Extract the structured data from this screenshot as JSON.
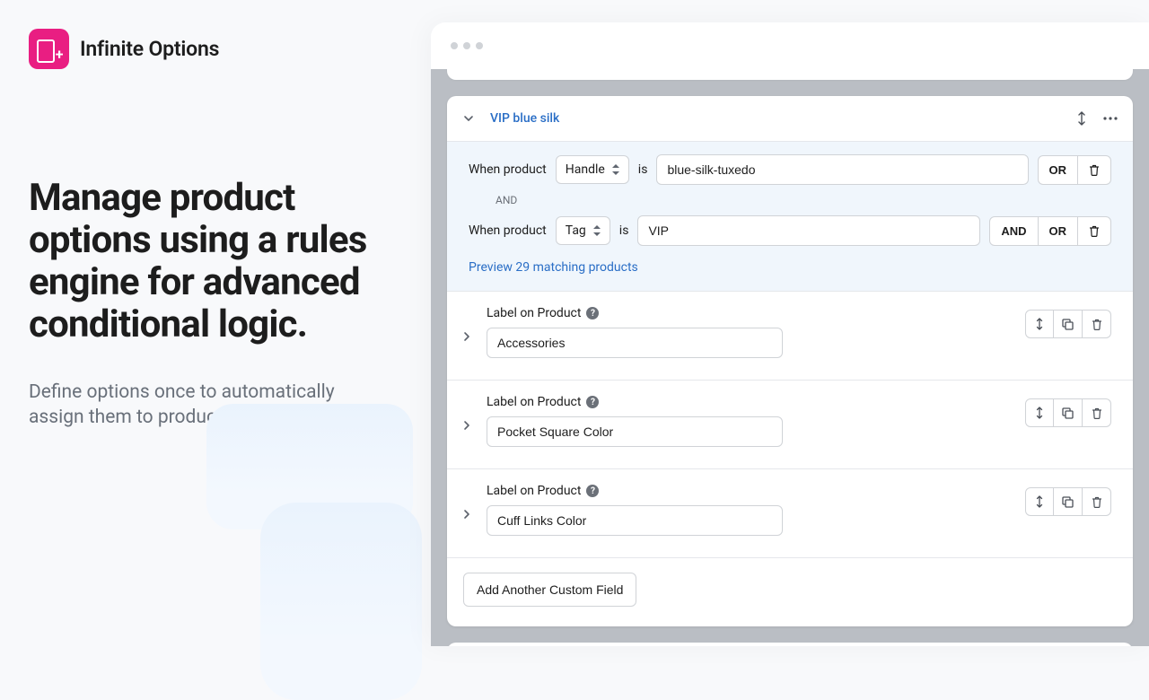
{
  "brand": {
    "name": "Infinite Options"
  },
  "marketing": {
    "headline": "Manage product options using a rules engine for advanced conditional logic.",
    "subheadline": "Define options once to automatically assign them to products."
  },
  "rule": {
    "title": "VIP blue silk",
    "conditions": {
      "label": "When product",
      "isLabel": "is",
      "joiner": "AND",
      "row1": {
        "selector": "Handle",
        "value": "blue-silk-tuxedo",
        "buttons": {
          "or": "OR"
        }
      },
      "row2": {
        "selector": "Tag",
        "value": "VIP",
        "buttons": {
          "and": "AND",
          "or": "OR"
        }
      },
      "preview": "Preview 29 matching products"
    },
    "optionLabel": "Label on Product",
    "options": [
      {
        "value": "Accessories"
      },
      {
        "value": "Pocket Square Color"
      },
      {
        "value": "Cuff Links Color"
      }
    ],
    "addButton": "Add Another Custom Field"
  }
}
